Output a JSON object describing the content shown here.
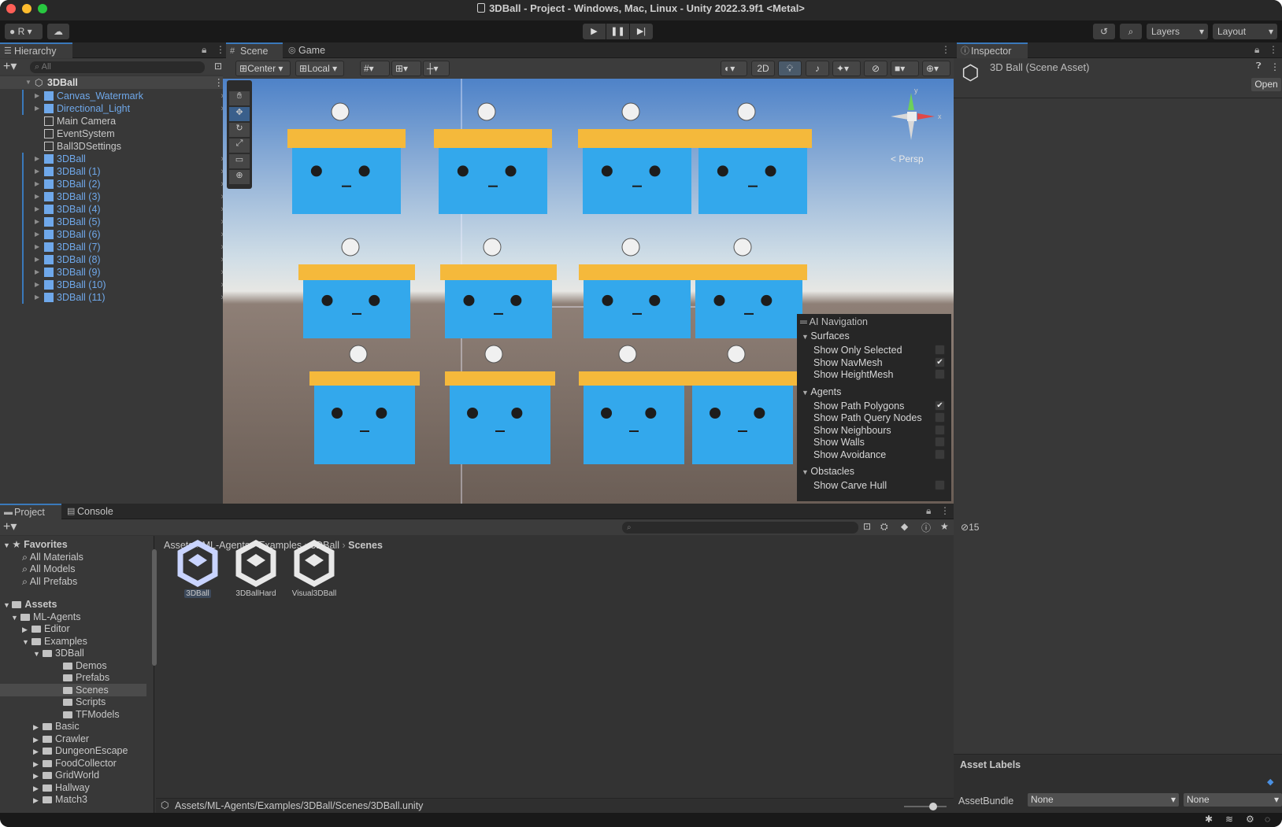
{
  "window": {
    "title": "3DBall - Project - Windows, Mac, Linux - Unity 2022.3.9f1 <Metal>"
  },
  "toolbar": {
    "account": "R",
    "layers": "Layers",
    "layout": "Layout"
  },
  "hierarchy": {
    "tab": "Hierarchy",
    "search_placeholder": "All",
    "scene": "3DBall",
    "items": [
      {
        "label": "Canvas_Watermark",
        "blue": true,
        "expand": true
      },
      {
        "label": "Directional_Light",
        "blue": true,
        "expand": true
      },
      {
        "label": "Main Camera",
        "blue": false,
        "expand": false
      },
      {
        "label": "EventSystem",
        "blue": false,
        "expand": false
      },
      {
        "label": "Ball3DSettings",
        "blue": false,
        "expand": false
      },
      {
        "label": "3DBall",
        "blue": true,
        "expand": true
      },
      {
        "label": "3DBall (1)",
        "blue": true,
        "expand": true
      },
      {
        "label": "3DBall (2)",
        "blue": true,
        "expand": true
      },
      {
        "label": "3DBall (3)",
        "blue": true,
        "expand": true
      },
      {
        "label": "3DBall (4)",
        "blue": true,
        "expand": true
      },
      {
        "label": "3DBall (5)",
        "blue": true,
        "expand": true
      },
      {
        "label": "3DBall (6)",
        "blue": true,
        "expand": true
      },
      {
        "label": "3DBall (7)",
        "blue": true,
        "expand": true
      },
      {
        "label": "3DBall (8)",
        "blue": true,
        "expand": true
      },
      {
        "label": "3DBall (9)",
        "blue": true,
        "expand": true
      },
      {
        "label": "3DBall (10)",
        "blue": true,
        "expand": true
      },
      {
        "label": "3DBall (11)",
        "blue": true,
        "expand": true
      }
    ]
  },
  "scene_view": {
    "tab_scene": "Scene",
    "tab_game": "Game",
    "pivot": "Center",
    "space": "Local",
    "mode_2d": "2D",
    "persp": "Persp"
  },
  "ai_navigation": {
    "title": "AI Navigation",
    "sections": [
      {
        "name": "Surfaces",
        "items": [
          {
            "label": "Show Only Selected",
            "checked": false
          },
          {
            "label": "Show NavMesh",
            "checked": true
          },
          {
            "label": "Show HeightMesh",
            "checked": false
          }
        ]
      },
      {
        "name": "Agents",
        "items": [
          {
            "label": "Show Path Polygons",
            "checked": true
          },
          {
            "label": "Show Path Query Nodes",
            "checked": false
          },
          {
            "label": "Show Neighbours",
            "checked": false
          },
          {
            "label": "Show Walls",
            "checked": false
          },
          {
            "label": "Show Avoidance",
            "checked": false
          }
        ]
      },
      {
        "name": "Obstacles",
        "items": [
          {
            "label": "Show Carve Hull",
            "checked": false
          }
        ]
      }
    ]
  },
  "inspector": {
    "tab": "Inspector",
    "asset_title": "3D Ball (Scene Asset)",
    "open_label": "Open",
    "asset_labels": "Asset Labels",
    "assetbundle_label": "AssetBundle",
    "assetbundle_value": "None",
    "variant_value": "None"
  },
  "project": {
    "tab_project": "Project",
    "tab_console": "Console",
    "hidden_count": "15",
    "favorites_label": "Favorites",
    "favorites": [
      "All Materials",
      "All Models",
      "All Prefabs"
    ],
    "assets_label": "Assets",
    "tree": [
      {
        "label": "ML-Agents",
        "depth": 1,
        "open": true
      },
      {
        "label": "Editor",
        "depth": 2,
        "open": false
      },
      {
        "label": "Examples",
        "depth": 2,
        "open": true
      },
      {
        "label": "3DBall",
        "depth": 3,
        "open": true
      },
      {
        "label": "Demos",
        "depth": 4,
        "open": null
      },
      {
        "label": "Prefabs",
        "depth": 4,
        "open": null
      },
      {
        "label": "Scenes",
        "depth": 4,
        "open": null,
        "selected": true
      },
      {
        "label": "Scripts",
        "depth": 4,
        "open": null
      },
      {
        "label": "TFModels",
        "depth": 4,
        "open": null
      },
      {
        "label": "Basic",
        "depth": 3,
        "open": false
      },
      {
        "label": "Crawler",
        "depth": 3,
        "open": false
      },
      {
        "label": "DungeonEscape",
        "depth": 3,
        "open": false
      },
      {
        "label": "FoodCollector",
        "depth": 3,
        "open": false
      },
      {
        "label": "GridWorld",
        "depth": 3,
        "open": false
      },
      {
        "label": "Hallway",
        "depth": 3,
        "open": false
      },
      {
        "label": "Match3",
        "depth": 3,
        "open": false
      }
    ],
    "breadcrumb": [
      "Assets",
      "ML-Agents",
      "Examples",
      "3DBall",
      "Scenes"
    ],
    "assets": [
      "3DBall",
      "3DBallHard",
      "Visual3DBall"
    ],
    "path": "Assets/ML-Agents/Examples/3DBall/Scenes/3DBall.unity"
  },
  "colors": {
    "accent": "#3a79bb",
    "hierarchy_blue": "#6fa8ea",
    "cube": "#33a8ec",
    "cube_band": "#f5b93b"
  }
}
